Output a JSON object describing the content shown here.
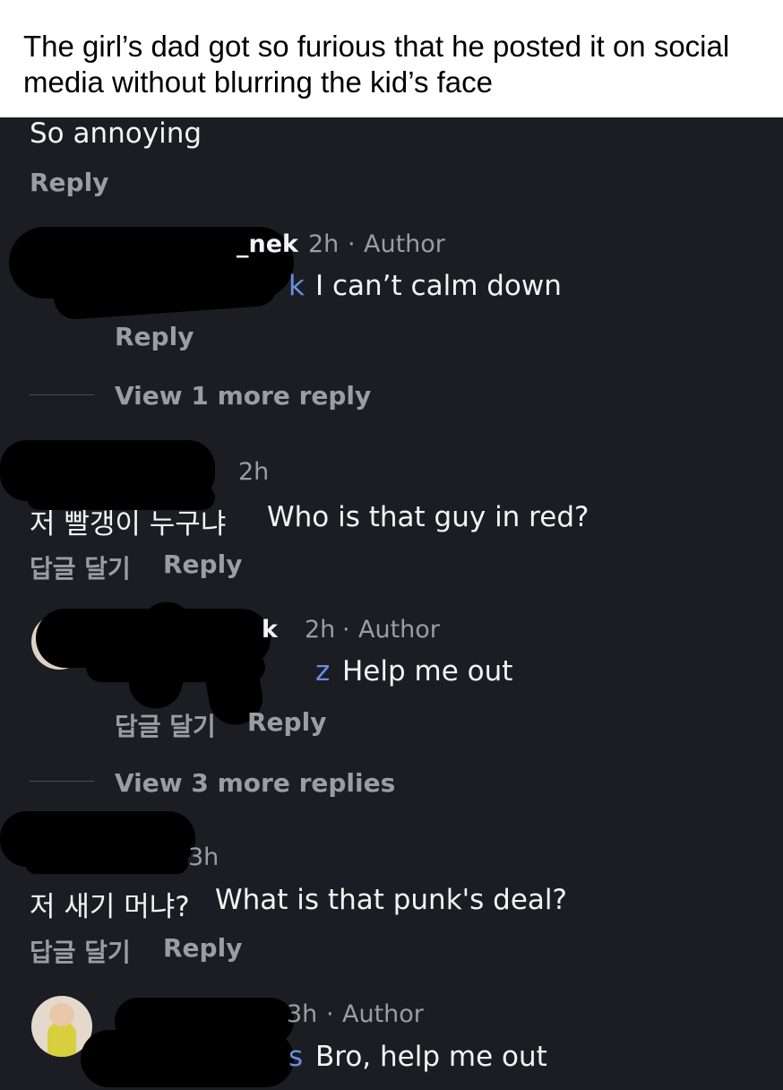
{
  "caption": "The girl’s dad got so furious that he posted it on social media without blurring the kid’s face",
  "comments": [
    {
      "body": "So annoying",
      "actions": {
        "reply": "Reply"
      }
    },
    {
      "username_partial": "_nek",
      "time": "2h",
      "separator": "·",
      "badge": "Author",
      "body_prefix": "k",
      "body": "I can’t calm down",
      "actions": {
        "reply": "Reply"
      },
      "view_more": "View 1 more reply"
    },
    {
      "time": "2h",
      "body_korean": "저 빨갱이 누구냐",
      "body": "Who is that guy in red?",
      "actions": {
        "korean_reply": "답글 달기",
        "reply": "Reply"
      }
    },
    {
      "username_partial": "k",
      "time": "2h",
      "separator": "·",
      "badge": "Author",
      "body_prefix": "z",
      "body": "Help me out",
      "actions": {
        "korean_reply": "답글 달기",
        "reply": "Reply"
      },
      "view_more": "View 3 more replies"
    },
    {
      "time": "3h",
      "body_korean": "저 새기 머냐?",
      "body": "What is that punk's deal?",
      "actions": {
        "korean_reply": "답글 달기",
        "reply": "Reply"
      }
    },
    {
      "time": "3h",
      "separator": "·",
      "badge": "Author",
      "body_prefix": "s",
      "body": "Bro, help me out"
    }
  ],
  "colors": {
    "panel_bg": "#1b1d23",
    "text": "#f2f3f5",
    "muted": "#9a9da3",
    "link": "#6a8ee0",
    "redaction": "#000000"
  }
}
